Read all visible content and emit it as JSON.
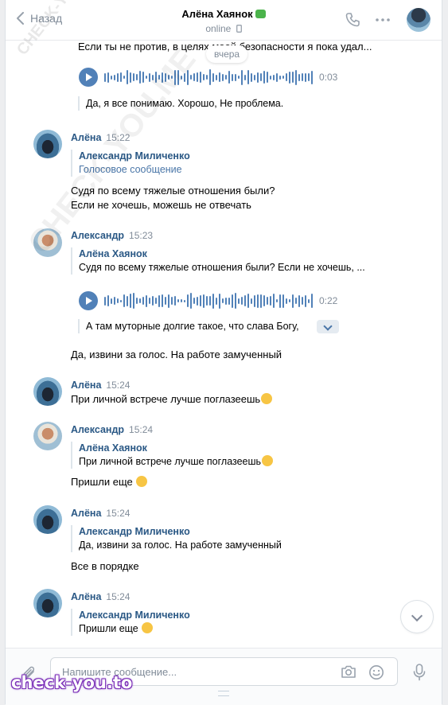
{
  "header": {
    "back_label": "Назад",
    "title": "Алёна Хаянок",
    "status": "online"
  },
  "date_badge": "вчера",
  "colors": {
    "accent": "#5181b8",
    "name": "#2a5885",
    "muted": "#818c99"
  },
  "messages": [
    {
      "text": "Если ты не против, в целях моей безопасности я пока удал...",
      "audio_duration": "0:03",
      "transcript": "Да, я все понимаю. Хорошо, Не проблема."
    },
    {
      "author": "Алёна",
      "time": "15:22",
      "quote_author": "Александр Миличенко",
      "quote_text": "Голосовое сообщение",
      "text_line1": "Судя по всему тяжелые отношения были?",
      "text_line2": "Если не хочешь, можешь не отвечать"
    },
    {
      "author": "Александр",
      "time": "15:23",
      "quote_author": "Алёна Хаянок",
      "quote_text": "Судя по всему тяжелые отношения были? Если не хочешь, ...",
      "audio_duration": "0:22",
      "transcript": "А там муторные долгие такое, что слава Богу,",
      "text": "Да, извини за голос. На работе замученный"
    },
    {
      "author": "Алёна",
      "time": "15:24",
      "text": "При личной встрече лучше поглазеешь"
    },
    {
      "author": "Александр",
      "time": "15:24",
      "quote_author": "Алёна Хаянок",
      "quote_text": "При личной встрече лучше поглазеешь",
      "text": "Пришли еще"
    },
    {
      "author": "Алёна",
      "time": "15:24",
      "quote_author": "Александр Миличенко",
      "quote_text": "Да, извини за голос. На работе замученный",
      "text": "Все в порядке"
    },
    {
      "author": "Алёна",
      "time": "15:24",
      "quote_author": "Александр Миличенко",
      "quote_text": "Пришли еще"
    }
  ],
  "composer": {
    "placeholder": "Напишите сообщение..."
  },
  "watermarks": {
    "diagonal": "CHECK-YOU.ME",
    "logo": "check-you.to"
  }
}
